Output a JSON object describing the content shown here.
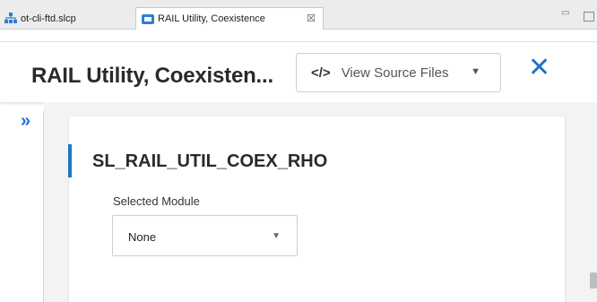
{
  "tabs": [
    {
      "label": "ot-cli-ftd.slcp"
    },
    {
      "label": "RAIL Utility, Coexistence",
      "close": "☒"
    }
  ],
  "window_controls": {
    "minimize": "▭"
  },
  "header": {
    "title": "RAIL Utility, Coexisten...",
    "view_source": {
      "icon": "</>",
      "label": "View Source Files"
    },
    "close": "✕"
  },
  "sidebar": {
    "expand": "»"
  },
  "component": {
    "section_title": "SL_RAIL_UTIL_COEX_RHO",
    "field_label": "Selected Module",
    "selected_value": "None"
  },
  "colors": {
    "accent": "#1d74c9"
  }
}
